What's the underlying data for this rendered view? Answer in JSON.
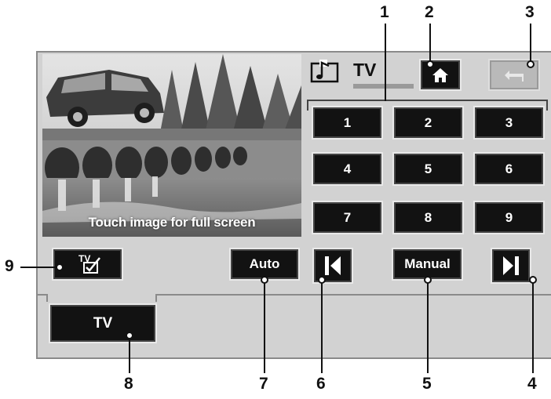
{
  "video": {
    "caption": "Touch image for full screen"
  },
  "header": {
    "source_label": "TV"
  },
  "presets": [
    "1",
    "2",
    "3",
    "4",
    "5",
    "6",
    "7",
    "8",
    "9"
  ],
  "controls": {
    "auto": "Auto",
    "manual": "Manual",
    "tv_tab": "TV"
  },
  "tv_icon_text": "TV",
  "callouts": [
    "1",
    "2",
    "3",
    "4",
    "5",
    "6",
    "7",
    "8",
    "9"
  ]
}
